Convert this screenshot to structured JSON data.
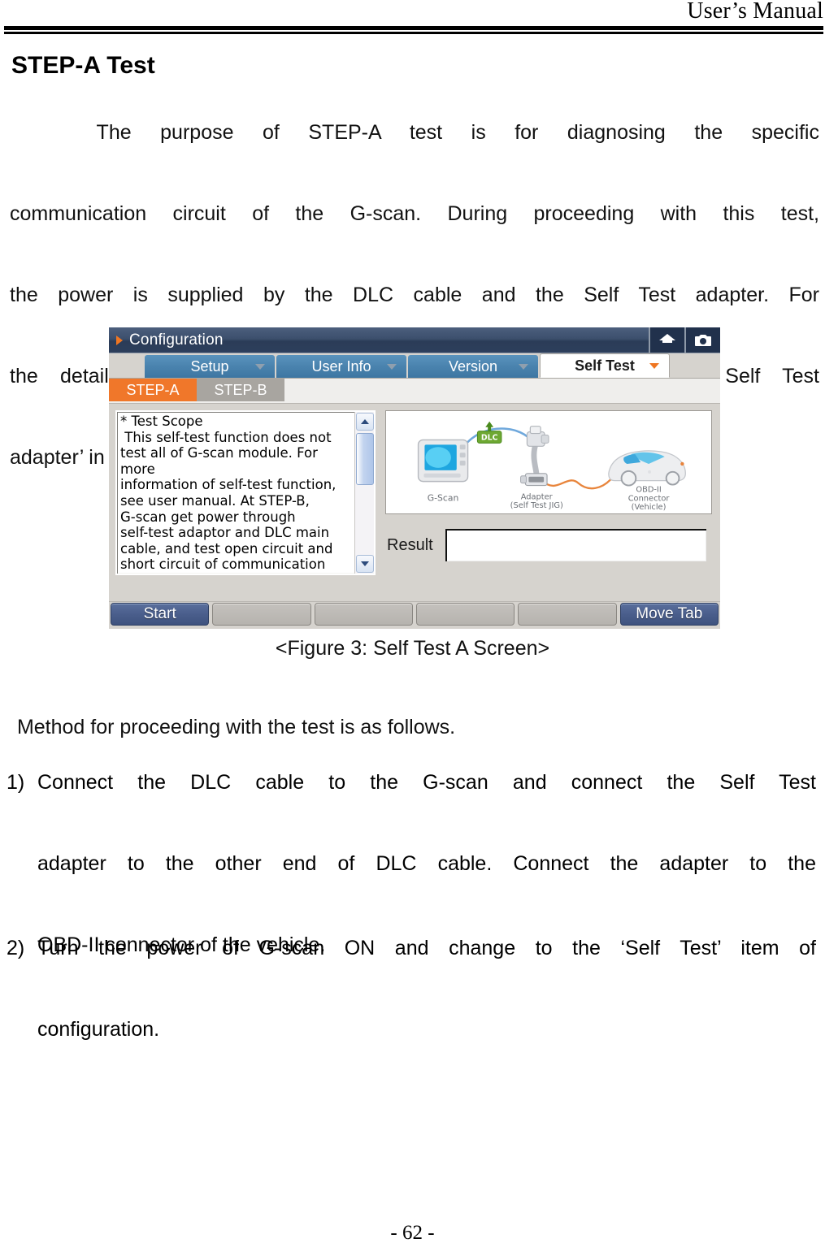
{
  "page": {
    "header_title": "User’s Manual",
    "footer": "- 62 -",
    "section_heading": "STEP-A Test"
  },
  "intro": {
    "line1": "   The purpose of STEP-A test is for diagnosing the specific",
    "line2": "communication circuit of the G-scan. During proceeding with this test,",
    "line3": "the power is supplied by the DLC cable and the Self Test adapter. For",
    "line4": "the details of Self Test adapter, refer to the ‘Connecting the Self Test",
    "line5": "adapter’ in the ‘Basic Use of G-scan’."
  },
  "figure": {
    "caption": "<Figure 3: Self Test A Screen>",
    "window": {
      "title": "Configuration",
      "titlebar_icons": [
        {
          "name": "home-icon",
          "label": "Home"
        },
        {
          "name": "camera-icon",
          "label": "Screen Capture"
        }
      ],
      "tabs": [
        {
          "label": "Setup",
          "active": false
        },
        {
          "label": "User Info",
          "active": false
        },
        {
          "label": "Version",
          "active": false
        },
        {
          "label": "Self Test",
          "active": true
        }
      ],
      "subtabs": [
        {
          "label": "STEP-A",
          "active": true
        },
        {
          "label": "STEP-B",
          "active": false
        }
      ],
      "scope_text": "* Test Scope\n This self-test function does not\ntest all of G-scan module. For more\ninformation of self-test function,\nsee user manual. At STEP-B,\nG-scan get power through\nself-test adaptor and DLC main\ncable, and test open circuit and\nshort circuit of communication lines",
      "diagram": {
        "dlc_badge": "DLC",
        "device_label": "G-Scan",
        "adapter_label_line1": "Adapter",
        "adapter_label_line2": "(Self Test JIG)",
        "vehicle_label_line1": "OBD-II",
        "vehicle_label_line2": "Connector",
        "vehicle_label_line3": "(Vehicle)"
      },
      "result": {
        "label": "Result",
        "value": ""
      },
      "buttons": [
        {
          "label": "Start",
          "style": "primary"
        },
        {
          "label": "",
          "style": "blank"
        },
        {
          "label": "",
          "style": "blank"
        },
        {
          "label": "",
          "style": "blank"
        },
        {
          "label": "",
          "style": "blank"
        },
        {
          "label": "Move Tab",
          "style": "primary"
        }
      ]
    },
    "colors": {
      "titlebar": "#2d3f5c",
      "tab_inactive": "#4a83ae",
      "subtab_active": "#f0772a",
      "subtab_inactive": "#a8a5a0",
      "button_primary": "#4a5e8c",
      "button_blank": "#b6b3ae",
      "window_bg": "#d6d3ce"
    }
  },
  "method": {
    "intro": " Method for proceeding with the test is as follows.",
    "items": [
      {
        "marker": "1)",
        "line1": "Connect the DLC cable to the G-scan and connect the Self Test",
        "line2": "adapter to the other end of DLC cable. Connect the adapter to the",
        "line3": "OBD-II connector of the vehicle."
      },
      {
        "marker": "2)",
        "line1": "Turn the power of G-scan ON and change to the ‘Self Test’ item of",
        "line2": "configuration."
      }
    ]
  }
}
